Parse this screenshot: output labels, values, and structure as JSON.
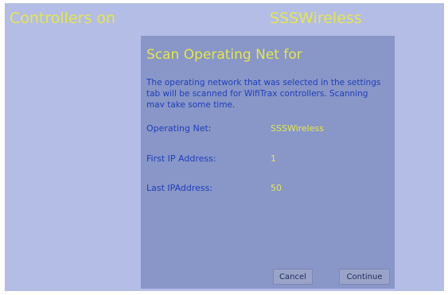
{
  "background": {
    "title_left": "Controllers on",
    "title_right": "SSSWireless"
  },
  "dialog": {
    "title": "Scan Operating Net for",
    "description": "The operating network that was selected in the settings tab will be scanned for WifiTrax controllers. Scanning may take some time.",
    "fields": [
      {
        "label": "Operating Net:",
        "value": "SSSWireless"
      },
      {
        "label": "First IP Address:",
        "value": "1"
      },
      {
        "label": "Last IPAddress:",
        "value": "50"
      }
    ],
    "buttons": {
      "cancel": "Cancel",
      "continue": "Continue"
    }
  },
  "colors": {
    "background": "#b4bde6",
    "dialog": "#8896c8",
    "accent_yellow": "#e6e64a",
    "label_blue": "#1f3fb8"
  }
}
